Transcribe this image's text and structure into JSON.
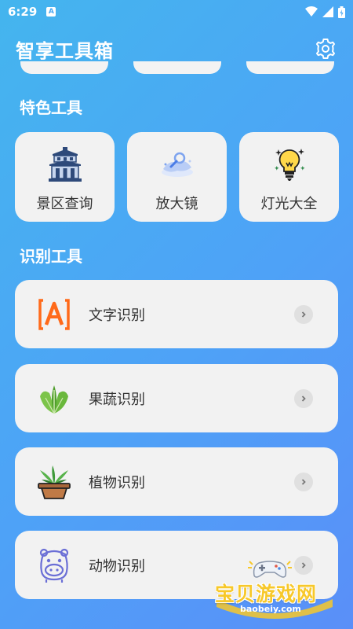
{
  "status": {
    "time": "6:29",
    "notif_icon": "A"
  },
  "header": {
    "title": "智享工具箱",
    "settings_icon": "gear-icon"
  },
  "featured": {
    "title": "特色工具",
    "items": [
      {
        "label": "景区查询",
        "icon": "pagoda-icon"
      },
      {
        "label": "放大镜",
        "icon": "magnifier-icon"
      },
      {
        "label": "灯光大全",
        "icon": "lightbulb-icon"
      }
    ]
  },
  "recognition": {
    "title": "识别工具",
    "items": [
      {
        "label": "文字识别",
        "icon": "text-scan-icon"
      },
      {
        "label": "果蔬识别",
        "icon": "leafy-vegetable-icon"
      },
      {
        "label": "植物识别",
        "icon": "potted-plant-icon"
      },
      {
        "label": "动物识别",
        "icon": "hippo-icon"
      }
    ]
  },
  "watermark": {
    "text": "宝贝游戏网",
    "url": "baobeiy.com"
  },
  "colors": {
    "gradient_start": "#44b5ee",
    "gradient_end": "#5a8ff8",
    "card_bg": "#f2f2f2",
    "text_icon": "#ff6a1a"
  }
}
